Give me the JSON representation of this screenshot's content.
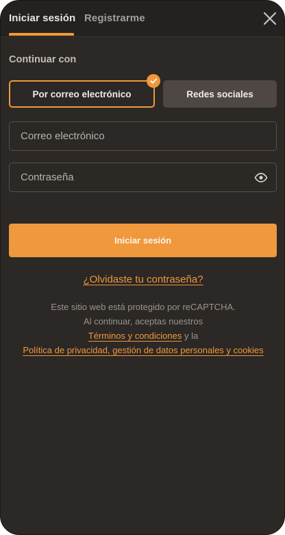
{
  "tabs": {
    "login": "Iniciar sesión",
    "register": "Registrarme"
  },
  "section_label": "Continuar con",
  "methods": {
    "email": "Por correo electrónico",
    "social": "Redes sociales"
  },
  "form": {
    "email_placeholder": "Correo electrónico",
    "password_placeholder": "Contraseña",
    "submit": "Iniciar sesión",
    "forgot": "¿Olvidaste tu contraseña?"
  },
  "legal": {
    "line1": "Este sitio web está protegido por reCAPTCHA.",
    "line2": "Al continuar, aceptas nuestros",
    "terms_link": "Términos y condiciones",
    "conj": " y la",
    "privacy_link": "Política de privacidad, gestión de datos personales y cookies"
  },
  "colors": {
    "accent": "#f0983c",
    "background": "#2b2826",
    "header": "#242220"
  }
}
